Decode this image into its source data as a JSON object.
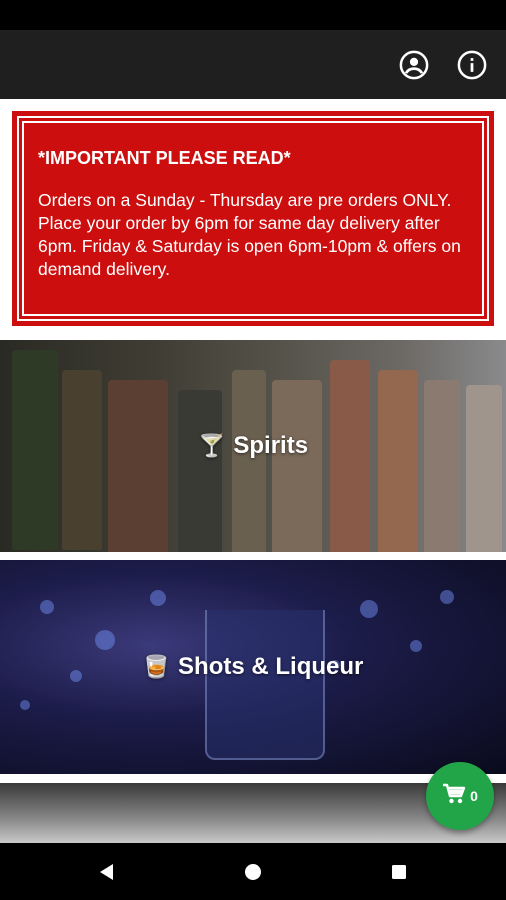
{
  "app_bar": {
    "account_icon": "account-circle-icon",
    "info_icon": "info-icon"
  },
  "notice": {
    "title": "*IMPORTANT PLEASE READ*",
    "body": "Orders on a Sunday - Thursday are pre orders ONLY. Place your order by 6pm for same day delivery after 6pm. Friday & Saturday is open 6pm-10pm & offers on demand delivery.",
    "background_color": "#cc0e0e"
  },
  "categories": [
    {
      "label": "Spirits",
      "emoji": "🍸"
    },
    {
      "label": "Shots & Liqueur",
      "emoji": "🥃"
    },
    {
      "label": "",
      "emoji": ""
    }
  ],
  "cart": {
    "count": "0",
    "icon": "cart-icon",
    "color": "#22a548"
  },
  "nav": {
    "back_icon": "back-icon",
    "home_icon": "home-icon",
    "recent_icon": "recent-apps-icon"
  }
}
